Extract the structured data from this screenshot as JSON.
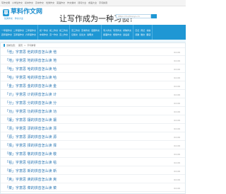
{
  "topbar": {
    "links": [
      "写作文网",
      "小学生作文",
      "初中作文",
      "高中作文",
      "优秀作文",
      "英语作文",
      "作文素材",
      "诗词大全",
      "成语大全",
      "字词拼音"
    ]
  },
  "header": {
    "logo_badge": "草",
    "logo_text": "草料作文网",
    "logo_sub": "优秀作文 · 作文大全",
    "slogan": "让写作成为一种习惯！",
    "search_placeholder": "https://m.jhliaoyu.cn"
  },
  "nav": {
    "columns": [
      {
        "row1": [
          "一年级作文",
          "二年级作文",
          "三年级作文"
        ],
        "row2": [
          "四年级作文",
          "五年级作文",
          "六年级作文"
        ]
      },
      {
        "row1": [
          "初一作文",
          "初二作文",
          "初三作文"
        ],
        "row2": [
          "中考作文",
          "高一作文",
          "高二作文"
        ]
      },
      {
        "row1": [
          "高三作文",
          "高考作文",
          "话题作文"
        ],
        "row2": [
          "记叙文",
          "议论文",
          "说明文"
        ]
      },
      {
        "row1": [
          "写人作文",
          "写景作文",
          "状物作文"
        ],
        "row2": [
          "叙事作文",
          "想象作文",
          "读后感"
        ]
      },
      {
        "row1": [
          "日记",
          "周记",
          "书信"
        ],
        "row2": [
          "诗歌",
          "散文",
          "童话"
        ]
      }
    ]
  },
  "breadcrumb": {
    "items": [
      "当前位置：",
      "首页",
      ">",
      "字词拼音"
    ]
  },
  "list": {
    "rows": [
      {
        "title": "「他」字意思 他的拼音怎么读 他",
        "date": "02-06"
      },
      {
        "title": "「地」字意思 地的拼音怎么读 地",
        "date": "02-06"
      },
      {
        "title": "「哈」字意思 哈的拼音怎么读 哈",
        "date": "02-06"
      },
      {
        "title": "「哈」字意思 哈的拼音怎么读 哈",
        "date": "02-06"
      },
      {
        "title": "「金」字意思 金的拼音怎么读 金",
        "date": "02-06"
      },
      {
        "title": "「计」字意思 计的拼音怎么读 计",
        "date": "02-06"
      },
      {
        "title": "「分」字意思 分的拼音怎么读 分",
        "date": "02-06"
      },
      {
        "title": "「功」字意思 功的拼音怎么读 功",
        "date": "02-06"
      },
      {
        "title": "「攘」字意思 攘的拼音怎么读 攘",
        "date": "02-06"
      },
      {
        "title": "「漂」字意思 漂的拼音怎么读 漂",
        "date": "02-06"
      },
      {
        "title": "「源」字意思 源的拼音怎么读 源",
        "date": "02-06"
      },
      {
        "title": "「择」字意思 择的拼音怎么读 择",
        "date": "02-06"
      },
      {
        "title": "「敬」字意思 敬的拼音怎么读 敬",
        "date": "02-06"
      },
      {
        "title": "「毯」字意思 毯的拼音怎么读 毯",
        "date": "02-06"
      },
      {
        "title": "「新」字意思 新的拼音怎么读 新",
        "date": "02-06"
      },
      {
        "title": "「爽」字意思 爽的拼音怎么读 爽",
        "date": "02-06"
      },
      {
        "title": "「菜」字意思 菜的拼音怎么读 菜",
        "date": "02-06"
      }
    ]
  }
}
